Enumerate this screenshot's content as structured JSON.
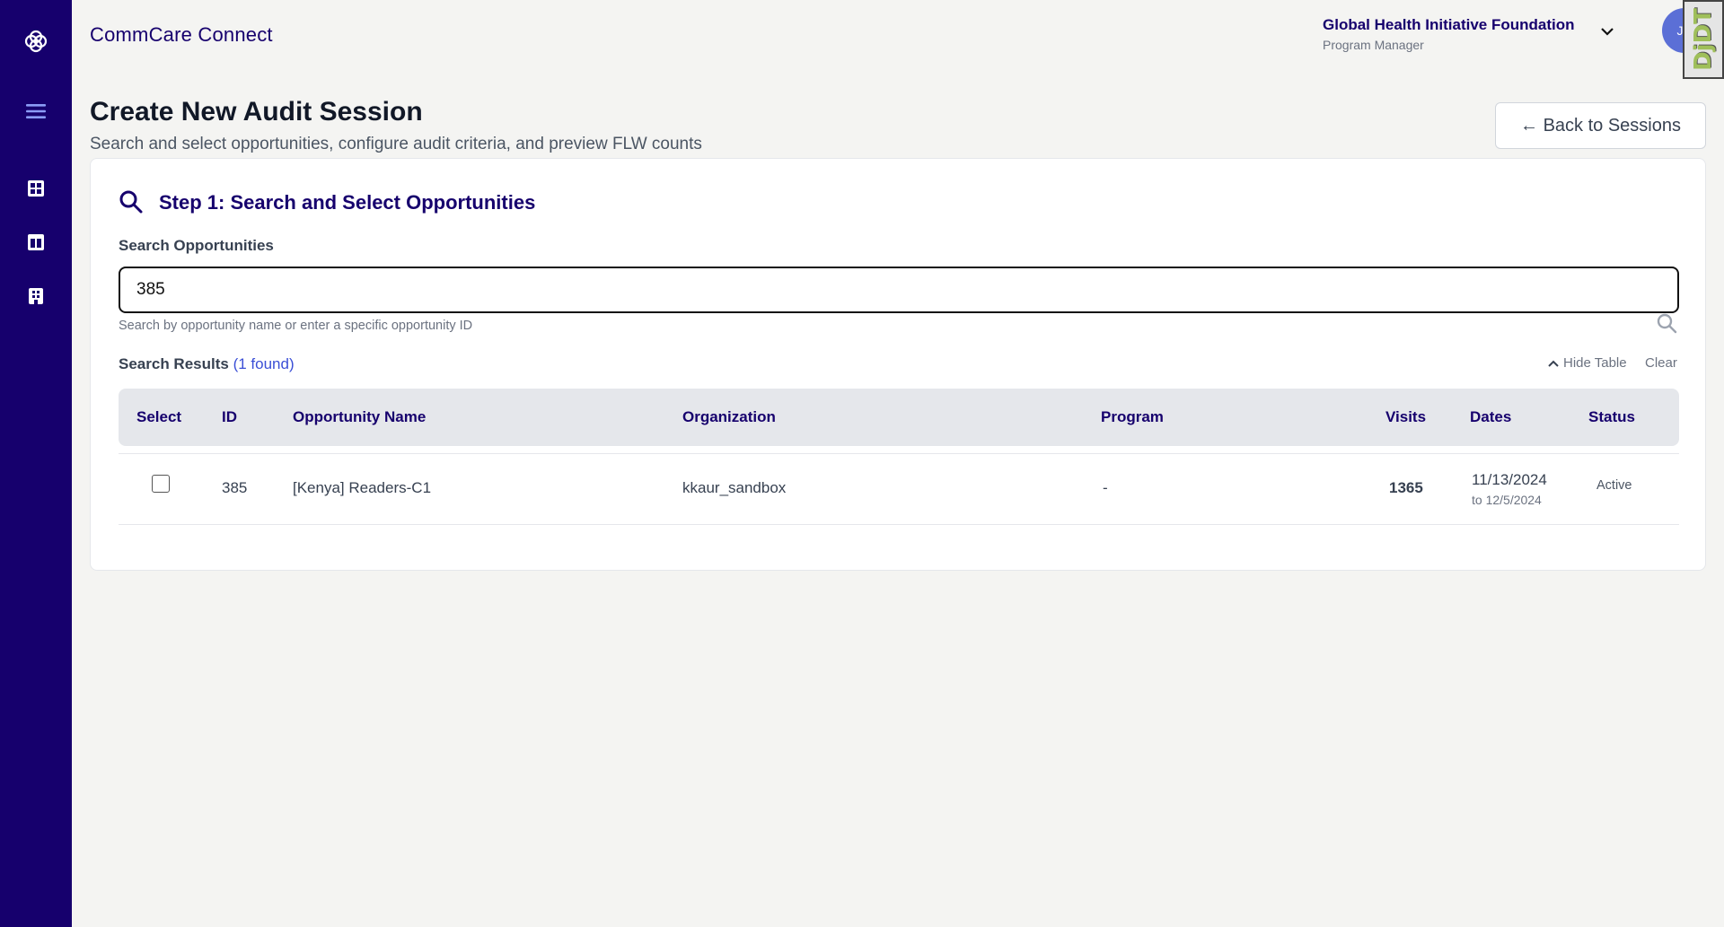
{
  "header": {
    "app_title": "CommCare Connect",
    "org_name": "Global Health Initiative Foundation",
    "org_role": "Program Manager",
    "avatar_initials": "JD",
    "debug_badge": "DjDT"
  },
  "sidebar": {
    "items": [
      {
        "icon": "logo-icon"
      },
      {
        "icon": "menu-icon"
      },
      {
        "icon": "dashboard-grid-icon"
      },
      {
        "icon": "columns-icon"
      },
      {
        "icon": "building-icon"
      }
    ]
  },
  "page": {
    "title": "Create New Audit Session",
    "subtitle": "Search and select opportunities, configure audit criteria, and preview FLW counts",
    "back_button": "← Back to Sessions"
  },
  "step1": {
    "title": "Step 1: Search and Select Opportunities",
    "search_label": "Search Opportunities",
    "search_value": "385",
    "helper": "Search by opportunity name or enter a specific opportunity ID",
    "results_label": "Search Results",
    "results_count": "(1 found)",
    "hide_table": "Hide Table",
    "clear": "Clear"
  },
  "table": {
    "columns": [
      "Select",
      "ID",
      "Opportunity Name",
      "Organization",
      "Program",
      "Visits",
      "Dates",
      "Status"
    ],
    "rows": [
      {
        "selected": false,
        "id": "385",
        "name": "[Kenya] Readers-C1",
        "organization": "kkaur_sandbox",
        "program": "-",
        "visits": "1365",
        "date_from": "11/13/2024",
        "date_to": "to 12/5/2024",
        "status": "Active"
      }
    ]
  },
  "colors": {
    "sidebar": "#16006d",
    "accent": "#16006d",
    "link": "#3b4fd6"
  }
}
